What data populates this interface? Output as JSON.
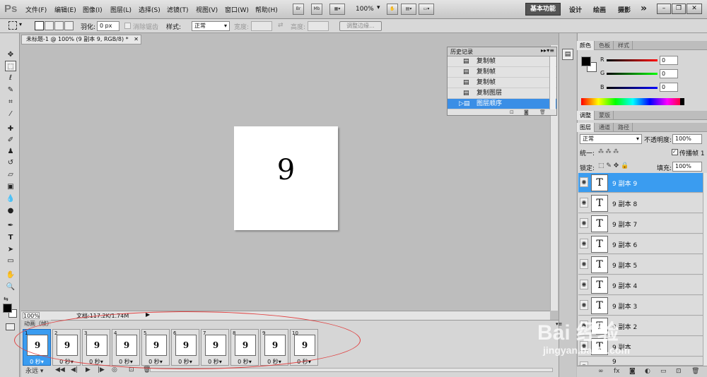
{
  "app": {
    "logo": "Ps"
  },
  "menu": [
    "文件(F)",
    "编辑(E)",
    "图像(I)",
    "图层(L)",
    "选择(S)",
    "滤镜(T)",
    "视图(V)",
    "窗口(W)",
    "帮助(H)"
  ],
  "appbar": {
    "br": "Br",
    "mb": "Mb",
    "zoom": "100%"
  },
  "workspaces": {
    "active": "基本功能",
    "items": [
      "设计",
      "绘画",
      "摄影"
    ],
    "more": "»"
  },
  "options": {
    "feather_label": "羽化:",
    "feather_value": "0 px",
    "antialias_label": "消除锯齿",
    "style_label": "样式:",
    "style_value": "正常",
    "width_label": "宽度:",
    "height_label": "高度:",
    "refine_button": "调整边缘..."
  },
  "document": {
    "tab_title": "未标题-1 @ 100% (9 副本 9, RGB/8) *",
    "canvas_text": "9",
    "zoom": "100%",
    "doc_info": "文档:117.2K/1.74M"
  },
  "history": {
    "title": "历史记录",
    "rows": [
      "复制帧",
      "复制帧",
      "复制帧",
      "复制图层",
      "图层顺序"
    ],
    "selected_index": 4
  },
  "color_panel": {
    "tabs": [
      "颜色",
      "色板",
      "样式"
    ],
    "labels": [
      "R",
      "G",
      "B"
    ],
    "values": [
      "0",
      "0",
      "0"
    ]
  },
  "adjust_tabs": [
    "调整",
    "蒙版"
  ],
  "layers_panel": {
    "tabs": [
      "图层",
      "通道",
      "路径"
    ],
    "blend_mode": "正常",
    "opacity_label": "不透明度:",
    "opacity_value": "100%",
    "unify_label": "统一:",
    "propagate_label": "传播帧 1",
    "lock_label": "锁定:",
    "fill_label": "填充:",
    "fill_value": "100%",
    "layers": [
      "9 副本 9",
      "9 副本 8",
      "9 副本 7",
      "9 副本 6",
      "9 副本 5",
      "9 副本 4",
      "9 副本 3",
      "9 副本 2",
      "9 副本",
      "9"
    ],
    "selected_index": 0
  },
  "animation": {
    "tab_title": "动画（帧）",
    "loop": "永远",
    "frames": [
      {
        "num": "1",
        "text": "9",
        "delay": "0 秒"
      },
      {
        "num": "2",
        "text": "9",
        "delay": "0 秒"
      },
      {
        "num": "3",
        "text": "9",
        "delay": "0 秒"
      },
      {
        "num": "4",
        "text": "9",
        "delay": "0 秒"
      },
      {
        "num": "5",
        "text": "9",
        "delay": "0 秒"
      },
      {
        "num": "6",
        "text": "9",
        "delay": "0 秒"
      },
      {
        "num": "7",
        "text": "9",
        "delay": "0 秒"
      },
      {
        "num": "8",
        "text": "9",
        "delay": "0 秒"
      },
      {
        "num": "9",
        "text": "9",
        "delay": "0 秒"
      },
      {
        "num": "10",
        "text": "9",
        "delay": "0 秒"
      }
    ],
    "selected_index": 0
  },
  "watermark": {
    "text": "Bai 经验",
    "sub": "jingyan.baidu.com"
  },
  "colors": {
    "selection": "#3a9cf0",
    "annotation": "#e04040"
  }
}
